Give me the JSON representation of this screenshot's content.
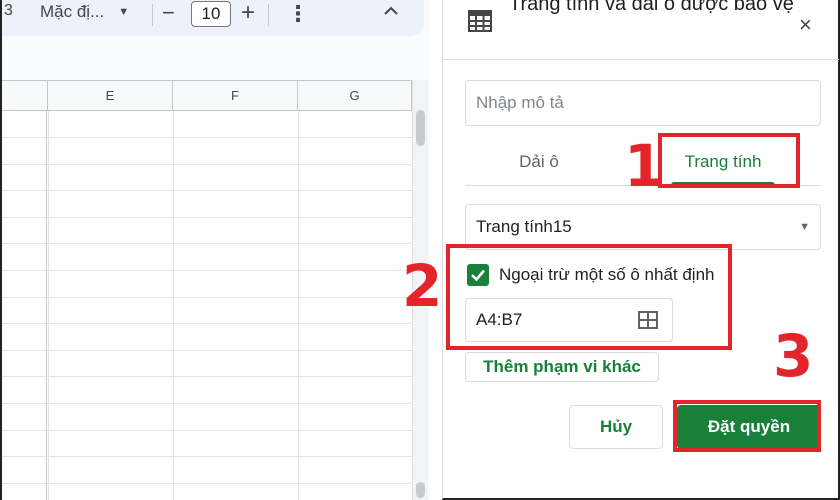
{
  "toolbar": {
    "partial_left": "3",
    "font_name": "Mặc đị...",
    "font_size": "10",
    "icons": [
      "chevron-down-icon",
      "minus-icon",
      "plus-icon",
      "more-vert-icon",
      "chevron-up-icon"
    ]
  },
  "grid": {
    "columns": [
      "E",
      "F",
      "G"
    ]
  },
  "panel": {
    "title": "Trang tính và dải ô được bảo vệ",
    "close_icon": "×",
    "description_placeholder": "Nhập mô tả",
    "tabs": [
      {
        "label": "Dải ô",
        "selected": false
      },
      {
        "label": "Trang tính",
        "selected": true
      }
    ],
    "sheet_select": {
      "value": "Trang tính15"
    },
    "except_cells": {
      "checked": true,
      "label": "Ngoại trừ một số ô nhất định"
    },
    "range_value": "A4:B7",
    "add_range_label": "Thêm phạm vi khác",
    "cancel_label": "Hủy",
    "confirm_label": "Đặt quyền"
  },
  "annotations": {
    "step1": "1",
    "step2": "2",
    "step3": "3"
  },
  "colors": {
    "accent_green": "#188038",
    "annotation_red": "#e1252b"
  }
}
